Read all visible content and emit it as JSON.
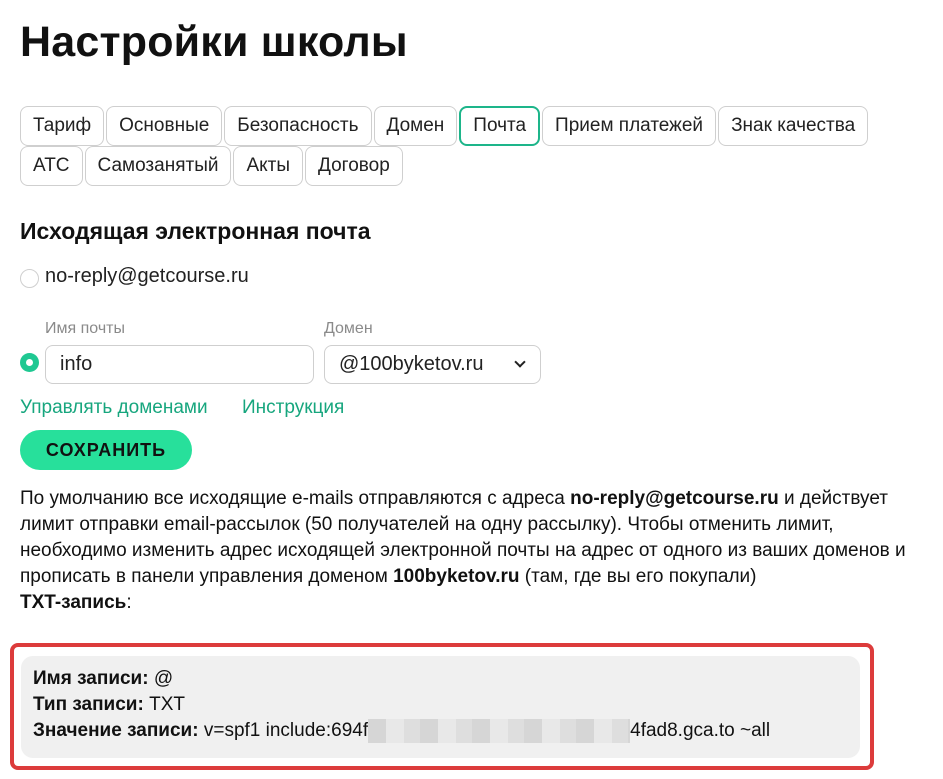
{
  "page_title": "Настройки школы",
  "tabs_row1": [
    "Тариф",
    "Основные",
    "Безопасность",
    "Домен",
    "Почта",
    "Прием платежей",
    "Знак качества"
  ],
  "tabs_row2": [
    "АТС",
    "Самозанятый",
    "Акты",
    "Договор"
  ],
  "active_tab": "Почта",
  "section": {
    "title": "Исходящая электронная почта",
    "default_option": "no-reply@getcourse.ru",
    "mail_name_label": "Имя почты",
    "mail_name_value": "info",
    "domain_label": "Домен",
    "domain_value": "@100byketov.ru",
    "manage_domains_link": "Управлять доменами",
    "instructions_link": "Инструкция",
    "save_button": "СОХРАНИТЬ"
  },
  "info": {
    "part1": "По умолчанию все исходящие e-mails отправляются с адреса ",
    "address": "no-reply@getcourse.ru",
    "part2": " и действует лимит отправки email-рассылок (50 получателей на одну рассылку). Чтобы отменить лимит, необходимо изменить адрес исходящей электронной почты на адрес от одного из ваших доменов и прописать в панели управления доменом ",
    "domain": "100byketov.ru",
    "part3": " (там, где вы его покупали)",
    "txt_label": "TXT-запись",
    "txt_colon": ":"
  },
  "record": {
    "name_label": "Имя записи:",
    "name_value": " @",
    "type_label": "Тип записи:",
    "type_value": " TXT",
    "value_label": "Значение записи:",
    "value_prefix": " v=spf1 include:694f",
    "value_suffix": "4fad8.gca.to ~all"
  },
  "colors": {
    "accent": "#27e09b",
    "link": "#17a67e",
    "highlight_border": "#dc3b3b"
  }
}
